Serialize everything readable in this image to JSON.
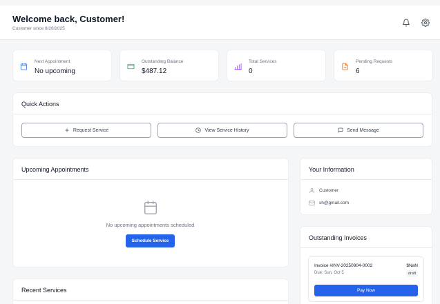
{
  "header": {
    "title": "Welcome back, Customer!",
    "subtitle": "Customer since 8/26/2025",
    "icons": [
      "bell-icon",
      "gear-icon"
    ]
  },
  "stats": [
    {
      "label": "Next Appointment",
      "value": "No upcoming",
      "icon": "calendar-icon",
      "color": "#3b82f6"
    },
    {
      "label": "Outstanding Balance",
      "value": "$487.12",
      "icon": "credit-card-icon",
      "color": "#22c55e"
    },
    {
      "label": "Total Services",
      "value": "0",
      "icon": "bar-chart-icon",
      "color": "#a855f7"
    },
    {
      "label": "Pending Requests",
      "value": "6",
      "icon": "document-icon",
      "color": "#f97316"
    }
  ],
  "quick_actions": {
    "title": "Quick Actions",
    "buttons": [
      {
        "label": "Request Service",
        "icon": "plus-icon"
      },
      {
        "label": "View Service History",
        "icon": "clock-icon"
      },
      {
        "label": "Send Message",
        "icon": "message-icon"
      }
    ]
  },
  "appointments": {
    "title": "Upcoming Appointments",
    "empty_text": "No upcoming appointments scheduled",
    "button_label": "Schedule Service"
  },
  "recent_services": {
    "title": "Recent Services"
  },
  "your_info": {
    "title": "Your Information",
    "name": "Customer",
    "email": "sh@gmail.com"
  },
  "invoices": {
    "title": "Outstanding Invoices",
    "items": [
      {
        "number": "Invoice #INV-20250904-0002",
        "due": "Due: Sun, Oct 5",
        "amount": "$NaN",
        "status": "draft",
        "button_label": "Pay Now"
      }
    ]
  },
  "colors": {
    "accent": "#2563eb",
    "background": "#f5f6f8",
    "card": "#ffffff"
  }
}
